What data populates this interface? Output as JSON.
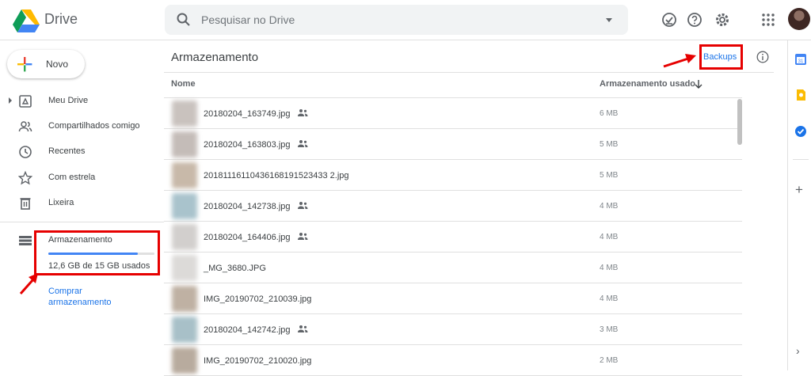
{
  "app": {
    "name": "Drive"
  },
  "search": {
    "placeholder": "Pesquisar no Drive"
  },
  "header_icons": [
    "offline-ready-icon",
    "help-icon",
    "settings-icon",
    "apps-grid-icon"
  ],
  "sidebar": {
    "new_label": "Novo",
    "items": [
      {
        "label": "Meu Drive",
        "icon": "my-drive-icon"
      },
      {
        "label": "Compartilhados comigo",
        "icon": "shared-with-me-icon"
      },
      {
        "label": "Recentes",
        "icon": "clock-icon"
      },
      {
        "label": "Com estrela",
        "icon": "star-icon"
      },
      {
        "label": "Lixeira",
        "icon": "trash-icon"
      }
    ],
    "storage": {
      "title": "Armazenamento",
      "used_text": "12,6 GB de 15 GB usados",
      "used_fraction": 0.84,
      "buy_label": "Comprar armazenamento"
    }
  },
  "main": {
    "title": "Armazenamento",
    "backups_label": "Backups",
    "columns": {
      "name": "Nome",
      "usage": "Armazenamento usado"
    },
    "files": [
      {
        "name": "20180204_163749.jpg",
        "shared": true,
        "size": "6 MB",
        "thumb": "#c9c2be"
      },
      {
        "name": "20180204_163803.jpg",
        "shared": true,
        "size": "5 MB",
        "thumb": "#c4bcb8"
      },
      {
        "name": "20181116110436168191523433 2.jpg",
        "shared": false,
        "size": "5 MB",
        "thumb": "#c8b9a9"
      },
      {
        "name": "20180204_142738.jpg",
        "shared": true,
        "size": "4 MB",
        "thumb": "#a9c3cc"
      },
      {
        "name": "20180204_164406.jpg",
        "shared": true,
        "size": "4 MB",
        "thumb": "#d2cfcd"
      },
      {
        "name": "_MG_3680.JPG",
        "shared": false,
        "size": "4 MB",
        "thumb": "#dcdad8"
      },
      {
        "name": "IMG_20190702_210039.jpg",
        "shared": false,
        "size": "4 MB",
        "thumb": "#bfb1a3"
      },
      {
        "name": "20180204_142742.jpg",
        "shared": true,
        "size": "3 MB",
        "thumb": "#a8c0c8"
      },
      {
        "name": "IMG_20190702_210020.jpg",
        "shared": false,
        "size": "2 MB",
        "thumb": "#b8ab9e"
      }
    ]
  },
  "right_rail": [
    "calendar-icon",
    "keep-icon",
    "tasks-icon"
  ],
  "colors": {
    "accent": "#1a73e8",
    "highlight": "#e60000",
    "storage_bar": "#4285f4"
  }
}
